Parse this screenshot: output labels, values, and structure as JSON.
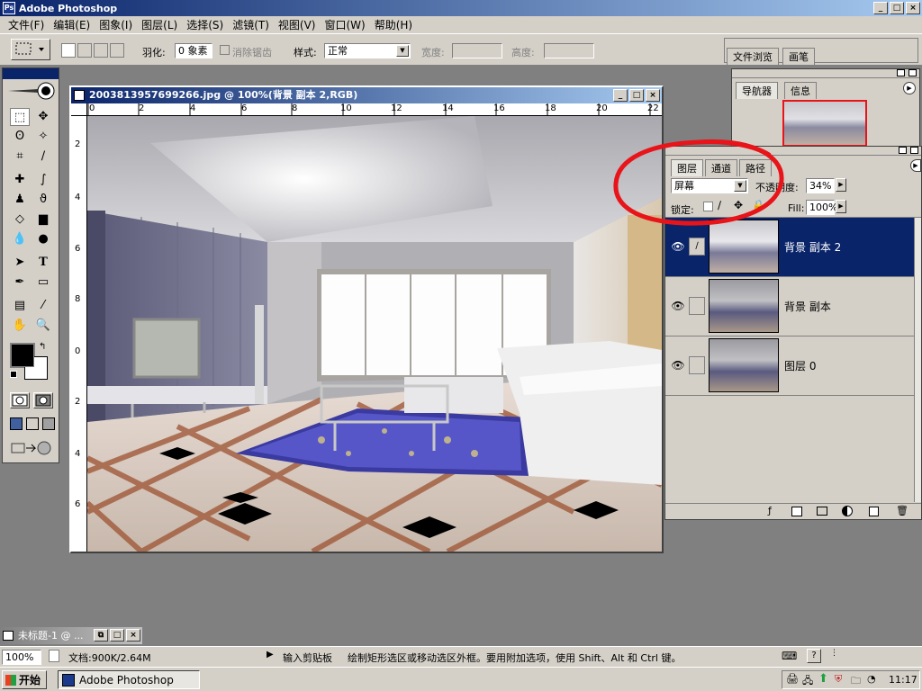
{
  "app": {
    "title": "Adobe Photoshop",
    "ps_logo": "Ps"
  },
  "window_buttons": {
    "minimize": "_",
    "maximize": "□",
    "close": "×"
  },
  "menu": [
    {
      "label": "文件(F)"
    },
    {
      "label": "编辑(E)"
    },
    {
      "label": "图象(I)"
    },
    {
      "label": "图层(L)"
    },
    {
      "label": "选择(S)"
    },
    {
      "label": "滤镜(T)"
    },
    {
      "label": "视图(V)"
    },
    {
      "label": "窗口(W)"
    },
    {
      "label": "帮助(H)"
    }
  ],
  "options": {
    "feather_label": "羽化:",
    "feather_value": "0 象素",
    "antialias_label": "消除锯齿",
    "style_label": "样式:",
    "style_value": "正常",
    "width_label": "宽度:",
    "height_label": "高度:",
    "tab_file_browser": "文件浏览",
    "tab_brushes": "画笔"
  },
  "document": {
    "title": "2003813957699266.jpg @ 100%(背景 副本 2,RGB)",
    "ruler_top": [
      "0",
      "2",
      "4",
      "6",
      "8",
      "10",
      "12",
      "14",
      "16",
      "18",
      "20",
      "22"
    ],
    "ruler_left": [
      "2",
      "4",
      "6",
      "8",
      "0",
      "2",
      "4",
      "6"
    ]
  },
  "navigator": {
    "tab_navigator": "导航器",
    "tab_info": "信息"
  },
  "layers": {
    "tab_layers": "图层",
    "tab_channels": "通道",
    "tab_paths": "路径",
    "blend_mode": "屏幕",
    "opacity_label": "不透明度:",
    "opacity_value": "34%",
    "lock_label": "锁定:",
    "fill_label": "Fill:",
    "fill_value": "100%",
    "items": [
      {
        "name": "背景 副本 2",
        "active": true
      },
      {
        "name": "背景 副本",
        "active": false
      },
      {
        "name": "图层 0",
        "active": false
      }
    ]
  },
  "minimized_doc": {
    "title": "未标题-1 @ ..."
  },
  "status": {
    "zoom": "100%",
    "doc_size": "文档:900K/2.64M",
    "clipboard": "输入剪贴板",
    "hint": "绘制矩形选区或移动选区外框。要用附加选项，使用 Shift、Alt 和 Ctrl 键。"
  },
  "taskbar": {
    "start_label": "开始",
    "task_label": "Adobe Photoshop",
    "clock": "11:17"
  },
  "colors": {
    "titlebar_start": "#0a246a",
    "titlebar_end": "#a6caf0",
    "chrome": "#d4d0c8",
    "workspace": "#808080",
    "annotation_red": "#e8141a"
  }
}
